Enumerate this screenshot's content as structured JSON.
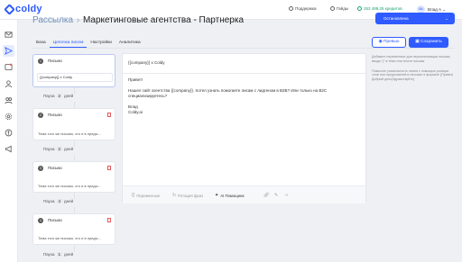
{
  "header": {
    "logo": "coldy",
    "support": "Поддержка",
    "guides": "Гайды",
    "credits": "253 488,25 кредитов",
    "avatar_initials": "ВА",
    "user_name": "Влад А",
    "user_caret": "⌄"
  },
  "sidebar": {
    "icons": [
      "mail-icon",
      "send-icon",
      "inbox-icon",
      "users-icon",
      "people-icon",
      "settings-icon",
      "money-icon",
      "megaphone-icon"
    ]
  },
  "page": {
    "breadcrumb": "Рассылка",
    "separator": "›",
    "title": "Маркетинговые агентства - Партнерка",
    "stop_label": "Остановлена",
    "stop_caret": "⌄"
  },
  "tabs": [
    "База",
    "Цепочка писем",
    "Настройки",
    "Аналитика"
  ],
  "actions": {
    "preview": "Превью",
    "save": "Сохранить"
  },
  "steps": [
    {
      "num": "1",
      "label": "Письмо",
      "subject": "{{company}} x Coldy",
      "preview": ""
    },
    {
      "num": "2",
      "label": "Письмо",
      "subject": "",
      "preview": "Тема того же письма, что и в преды..."
    },
    {
      "num": "3",
      "label": "Письмо",
      "subject": "",
      "preview": "Тема того же письма, что и в преды..."
    },
    {
      "num": "4",
      "label": "Письмо",
      "subject": "",
      "preview": "Тема того же письма, что и в преды..."
    }
  ],
  "delays": [
    {
      "prefix": "Пауза",
      "value": "2",
      "suffix": "дней"
    },
    {
      "prefix": "Пауза",
      "value": "2",
      "suffix": "дней"
    },
    {
      "prefix": "Пауза",
      "value": "4",
      "suffix": "дней"
    },
    {
      "prefix": "Пауза",
      "value": "1",
      "suffix": "дней"
    }
  ],
  "editor": {
    "subject": "{{company}} x Coldy",
    "greeting": "Привет!",
    "paragraph": "Нашел сайт агентства {{company}}. Хотел узнать помогаете лисам с лидгеном в B2B? Или только на B2C специализируетесь?",
    "sign_name": "Влад",
    "sign_company": "Coldy.ai",
    "toolbar": {
      "variables": "Переменные",
      "rotation": "Ротация фраз",
      "ai": "AI Помощник"
    }
  },
  "hints": {
    "variables_hint": "Добавьте переменные для персонализации письма, вводя \"{\" в теме или тексте письма",
    "rotation_hint": "Повысьте уникальность писем с помощью ротации слов или предложений в письмах в формате {Привет|Добрый день|Здравствуйте}"
  }
}
